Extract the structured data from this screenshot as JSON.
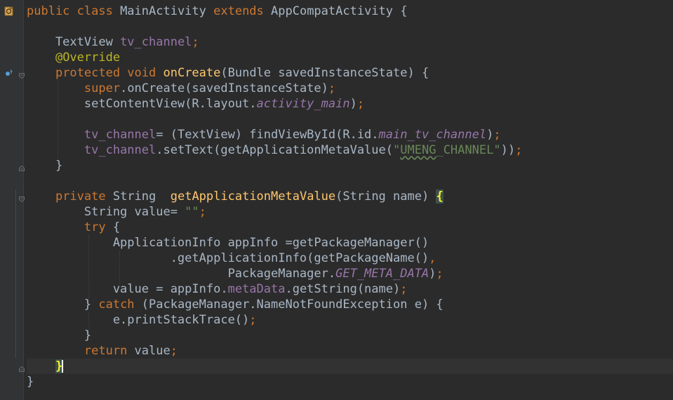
{
  "editor": {
    "language": "java",
    "lines": [
      [
        {
          "t": "public class ",
          "c": "kw"
        },
        {
          "t": "MainActivity ",
          "c": "mt"
        },
        {
          "t": "extends ",
          "c": "kw"
        },
        {
          "t": "AppCompatActivity {",
          "c": "mt"
        }
      ],
      [],
      [
        {
          "t": "    TextView ",
          "c": "mt"
        },
        {
          "t": "tv_channel",
          "c": "fld"
        },
        {
          "t": ";",
          "c": "kw"
        }
      ],
      [
        {
          "t": "    ",
          "c": "mt"
        },
        {
          "t": "@Override",
          "c": "an"
        }
      ],
      [
        {
          "t": "    ",
          "c": "mt"
        },
        {
          "t": "protected void ",
          "c": "kw"
        },
        {
          "t": "onCreate",
          "c": "fn"
        },
        {
          "t": "(Bundle savedInstanceState) {",
          "c": "mt"
        }
      ],
      [
        {
          "t": "        ",
          "c": "mt"
        },
        {
          "t": "super",
          "c": "kw"
        },
        {
          "t": ".onCreate(savedInstanceState)",
          "c": "mt"
        },
        {
          "t": ";",
          "c": "kw"
        }
      ],
      [
        {
          "t": "        setContentView(R.layout.",
          "c": "mt"
        },
        {
          "t": "activity_main",
          "c": "it"
        },
        {
          "t": ")",
          "c": "mt"
        },
        {
          "t": ";",
          "c": "kw"
        }
      ],
      [],
      [
        {
          "t": "        ",
          "c": "mt"
        },
        {
          "t": "tv_channel",
          "c": "fld"
        },
        {
          "t": "= (TextView) findViewById(R.id.",
          "c": "mt"
        },
        {
          "t": "main_tv_channel",
          "c": "it"
        },
        {
          "t": ")",
          "c": "mt"
        },
        {
          "t": ";",
          "c": "kw"
        }
      ],
      [
        {
          "t": "        ",
          "c": "mt"
        },
        {
          "t": "tv_channel",
          "c": "fld"
        },
        {
          "t": ".setText(getApplicationMetaValue(",
          "c": "mt"
        },
        {
          "t": "\"",
          "c": "str"
        },
        {
          "t": "UMENG",
          "c": "str squiggle"
        },
        {
          "t": "_CHANNEL\"",
          "c": "str"
        },
        {
          "t": "))",
          "c": "mt"
        },
        {
          "t": ";",
          "c": "kw"
        }
      ],
      [
        {
          "t": "    }",
          "c": "mt"
        }
      ],
      [],
      [
        {
          "t": "    ",
          "c": "mt"
        },
        {
          "t": "private ",
          "c": "kw"
        },
        {
          "t": "String  ",
          "c": "mt"
        },
        {
          "t": "getApplicationMetaValue",
          "c": "fn"
        },
        {
          "t": "(String name) ",
          "c": "mt"
        },
        {
          "t": "{",
          "c": "brace-match"
        }
      ],
      [
        {
          "t": "        String value= ",
          "c": "mt"
        },
        {
          "t": "\"\"",
          "c": "str"
        },
        {
          "t": ";",
          "c": "kw"
        }
      ],
      [
        {
          "t": "        ",
          "c": "mt"
        },
        {
          "t": "try ",
          "c": "kw"
        },
        {
          "t": "{",
          "c": "mt"
        }
      ],
      [
        {
          "t": "            ApplicationInfo appInfo =getPackageManager()",
          "c": "mt"
        }
      ],
      [
        {
          "t": "                    .getApplicationInfo(getPackageName()",
          "c": "mt"
        },
        {
          "t": ",",
          "c": "kw"
        }
      ],
      [
        {
          "t": "                            PackageManager.",
          "c": "mt"
        },
        {
          "t": "GET_META_DATA",
          "c": "it"
        },
        {
          "t": ")",
          "c": "mt"
        },
        {
          "t": ";",
          "c": "kw"
        }
      ],
      [
        {
          "t": "            value = appInfo.",
          "c": "mt"
        },
        {
          "t": "metaData",
          "c": "fld"
        },
        {
          "t": ".getString(name)",
          "c": "mt"
        },
        {
          "t": ";",
          "c": "kw"
        }
      ],
      [
        {
          "t": "        } ",
          "c": "mt"
        },
        {
          "t": "catch ",
          "c": "kw"
        },
        {
          "t": "(PackageManager.NameNotFoundException e) {",
          "c": "mt"
        }
      ],
      [
        {
          "t": "            e.printStackTrace()",
          "c": "mt"
        },
        {
          "t": ";",
          "c": "kw"
        }
      ],
      [
        {
          "t": "        }",
          "c": "mt"
        }
      ],
      [
        {
          "t": "        ",
          "c": "mt"
        },
        {
          "t": "return ",
          "c": "kw"
        },
        {
          "t": "value",
          "c": "mt"
        },
        {
          "t": ";",
          "c": "kw"
        }
      ],
      [
        {
          "t": "    ",
          "c": "mt"
        },
        {
          "t": "}",
          "c": "brace-match"
        },
        {
          "t": "",
          "c": "caret"
        }
      ],
      [
        {
          "t": "}",
          "c": "mt"
        }
      ]
    ],
    "current_line": 23,
    "colors": {
      "background": "#2b2b2b",
      "gutter": "#313335",
      "keyword": "#cc7832",
      "method": "#ffc66d",
      "annotation": "#bbb529",
      "field": "#9876aa",
      "string": "#6a8759",
      "text": "#a9b7c6"
    },
    "gutter_icons": [
      "class-file-icon",
      "override-method-icon"
    ]
  }
}
